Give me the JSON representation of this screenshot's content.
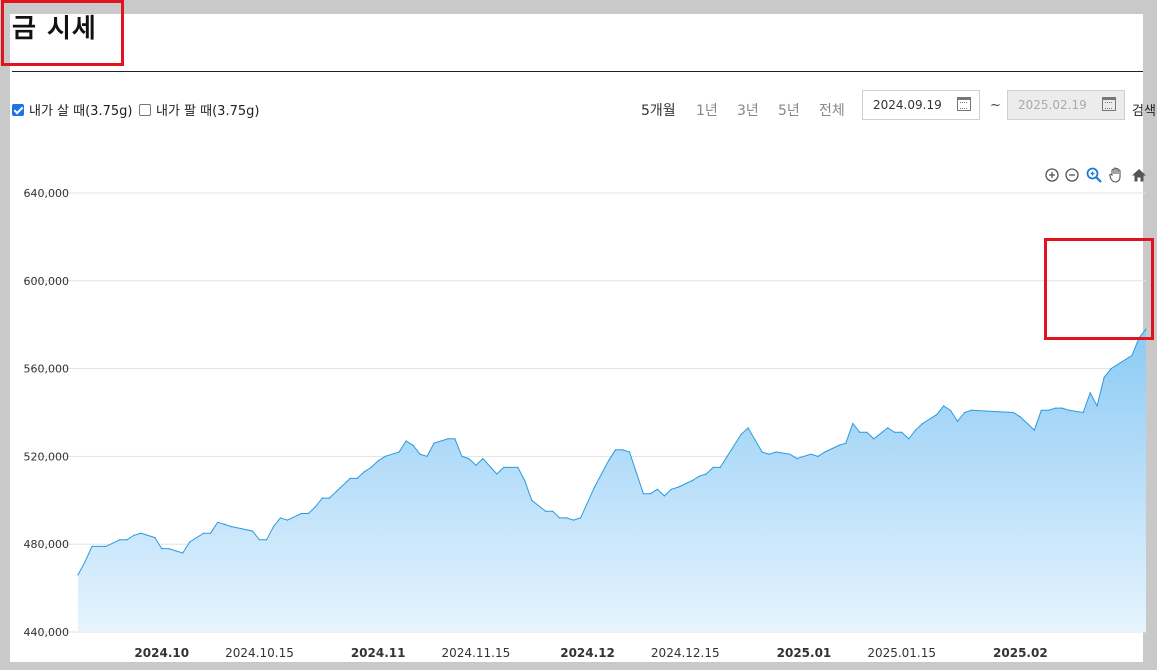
{
  "page": {
    "title": "금 시세",
    "buy_label": "내가 살 때(3.75g)",
    "buy_checked": true,
    "sell_label": "내가 팔 때(3.75g)",
    "sell_checked": false,
    "periods": [
      "5개월",
      "1년",
      "3년",
      "5년",
      "전체"
    ],
    "active_period": "5개월",
    "date_from": "2024.09.19",
    "date_to": "2025.02.19",
    "tilde": "~",
    "search_label": "검색",
    "toolbar_icons": [
      "zoom-in-icon",
      "zoom-out-icon",
      "magnifier-icon",
      "pan-hand-icon",
      "home-icon"
    ],
    "annotation_color": "#e0141e"
  },
  "chart_data": {
    "type": "area",
    "title": "",
    "xlabel": "",
    "ylabel": "",
    "ylim": [
      440000,
      640000
    ],
    "yticks": [
      440000,
      480000,
      520000,
      560000,
      600000,
      640000
    ],
    "ytick_labels": [
      "440,000",
      "480,000",
      "520,000",
      "560,000",
      "600,000",
      "640,000"
    ],
    "xlim": [
      "2024-09-19",
      "2025-02-19"
    ],
    "xticks": [
      {
        "date": "2024-10-01",
        "label": "2024.10",
        "bold": true
      },
      {
        "date": "2024-10-15",
        "label": "2024.10.15",
        "bold": false
      },
      {
        "date": "2024-11-01",
        "label": "2024.11",
        "bold": true
      },
      {
        "date": "2024-11-15",
        "label": "2024.11.15",
        "bold": false
      },
      {
        "date": "2024-12-01",
        "label": "2024.12",
        "bold": true
      },
      {
        "date": "2024-12-15",
        "label": "2024.12.15",
        "bold": false
      },
      {
        "date": "2025-01-01",
        "label": "2025.01",
        "bold": true
      },
      {
        "date": "2025-01-15",
        "label": "2025.01.15",
        "bold": false
      },
      {
        "date": "2025-02-01",
        "label": "2025.02",
        "bold": true
      }
    ],
    "grid": true,
    "line_color": "#2a9be0",
    "fill_top_color": "#8ccaf5",
    "fill_bottom_color": "#e6f4fe",
    "series": [
      {
        "x": [
          "2024-09-19",
          "2024-09-20",
          "2024-09-21",
          "2024-09-23",
          "2024-09-25",
          "2024-09-26",
          "2024-09-27",
          "2024-09-28",
          "2024-09-30",
          "2024-10-01",
          "2024-10-02",
          "2024-10-04",
          "2024-10-05",
          "2024-10-07",
          "2024-10-08",
          "2024-10-09",
          "2024-10-10",
          "2024-10-11",
          "2024-10-14",
          "2024-10-15",
          "2024-10-16",
          "2024-10-17",
          "2024-10-18",
          "2024-10-19",
          "2024-10-21",
          "2024-10-22",
          "2024-10-23",
          "2024-10-24",
          "2024-10-25",
          "2024-10-26",
          "2024-10-28",
          "2024-10-29",
          "2024-10-30",
          "2024-10-31",
          "2024-11-01",
          "2024-11-02",
          "2024-11-04",
          "2024-11-05",
          "2024-11-06",
          "2024-11-07",
          "2024-11-08",
          "2024-11-09",
          "2024-11-11",
          "2024-11-12",
          "2024-11-13",
          "2024-11-14",
          "2024-11-15",
          "2024-11-16",
          "2024-11-18",
          "2024-11-19",
          "2024-11-20",
          "2024-11-21",
          "2024-11-22",
          "2024-11-23",
          "2024-11-25",
          "2024-11-26",
          "2024-11-27",
          "2024-11-28",
          "2024-11-29",
          "2024-11-30",
          "2024-12-02",
          "2024-12-03",
          "2024-12-04",
          "2024-12-05",
          "2024-12-06",
          "2024-12-07",
          "2024-12-09",
          "2024-12-10",
          "2024-12-11",
          "2024-12-12",
          "2024-12-13",
          "2024-12-14",
          "2024-12-16",
          "2024-12-17",
          "2024-12-18",
          "2024-12-19",
          "2024-12-20",
          "2024-12-21",
          "2024-12-23",
          "2024-12-24",
          "2024-12-26",
          "2024-12-27",
          "2024-12-28",
          "2024-12-30",
          "2024-12-31",
          "2025-01-02",
          "2025-01-03",
          "2025-01-04",
          "2025-01-06",
          "2025-01-07",
          "2025-01-08",
          "2025-01-09",
          "2025-01-10",
          "2025-01-11",
          "2025-01-13",
          "2025-01-14",
          "2025-01-15",
          "2025-01-16",
          "2025-01-17",
          "2025-01-18",
          "2025-01-20",
          "2025-01-21",
          "2025-01-22",
          "2025-01-23",
          "2025-01-24",
          "2025-01-25",
          "2025-01-31",
          "2025-02-01",
          "2025-02-03",
          "2025-02-04",
          "2025-02-05",
          "2025-02-06",
          "2025-02-07",
          "2025-02-08",
          "2025-02-10",
          "2025-02-11",
          "2025-02-12",
          "2025-02-13",
          "2025-02-14",
          "2025-02-15",
          "2025-02-17",
          "2025-02-18",
          "2025-02-19"
        ],
        "y": [
          466000,
          472000,
          479000,
          479000,
          482000,
          482000,
          484000,
          485000,
          483000,
          478000,
          478000,
          476000,
          481000,
          485000,
          485000,
          490000,
          489000,
          488000,
          486000,
          482000,
          482000,
          488000,
          492000,
          491000,
          494000,
          494000,
          497000,
          501000,
          501000,
          504000,
          510000,
          510000,
          513000,
          515000,
          518000,
          520000,
          522000,
          527000,
          525000,
          521000,
          520000,
          526000,
          528000,
          528000,
          520000,
          519000,
          516000,
          519000,
          512000,
          515000,
          515000,
          515000,
          509000,
          500000,
          495000,
          495000,
          492000,
          492000,
          491000,
          492000,
          506000,
          512000,
          518000,
          523000,
          523000,
          522000,
          503000,
          503000,
          505000,
          502000,
          505000,
          506000,
          509000,
          511000,
          512000,
          515000,
          515000,
          520000,
          530000,
          533000,
          522000,
          521000,
          522000,
          521000,
          519000,
          521000,
          520000,
          522000,
          525000,
          526000,
          535000,
          531000,
          531000,
          528000,
          533000,
          531000,
          531000,
          528000,
          532000,
          535000,
          539000,
          543000,
          541000,
          536000,
          540000,
          541000,
          540000,
          538000,
          532000,
          541000,
          541000,
          542000,
          542000,
          541000,
          540000,
          549000,
          543000,
          556000,
          560000,
          562000,
          566000,
          574000,
          578000
        ]
      }
    ]
  }
}
